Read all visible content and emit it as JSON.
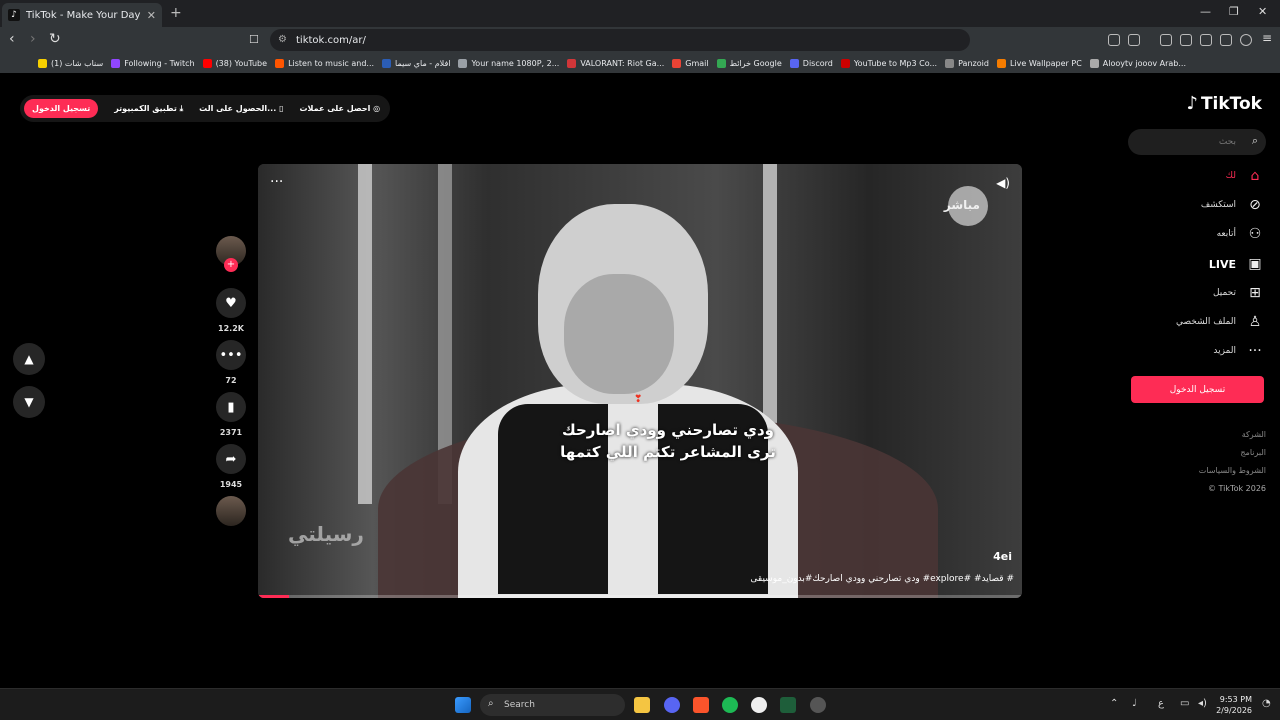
{
  "browser": {
    "tab_title": "TikTok - Make Your Day",
    "url": "tiktok.com/ar/",
    "bookmarks": [
      "(1) سناب شات",
      "Following - Twitch",
      "(38) YouTube",
      "Listen to music and...",
      "افلام - ماي سيما",
      "Your name 1080P, 2...",
      "VALORANT: Riot Ga...",
      "Gmail",
      "خرائط Google",
      "Discord",
      "YouTube to Mp3 Co...",
      "Panzoid",
      "Live Wallpaper PC",
      "Alooytv jooov Arab..."
    ],
    "bookmark_colors": [
      "#f7d000",
      "#9146ff",
      "#ff0000",
      "#ff5500",
      "#2b5db5",
      "#9aa0a6",
      "#d13639",
      "#ea4335",
      "#34a853",
      "#5865f2",
      "#c00",
      "#888",
      "#f57c00",
      "#aaa"
    ]
  },
  "header_actions": {
    "login": "تسجيل الدخول",
    "desktop_app": "تطبيق الكمبيوتر",
    "get_app": "الحصول على الت...",
    "coins": "احصل على عملات"
  },
  "logo": "TikTok",
  "search": {
    "placeholder": "بحث"
  },
  "nav": [
    {
      "label": "لك",
      "icon": "home-icon"
    },
    {
      "label": "استكشف",
      "icon": "compass-icon"
    },
    {
      "label": "أتابعه",
      "icon": "following-icon"
    },
    {
      "label": "LIVE",
      "icon": "live-icon"
    },
    {
      "label": "تحميل",
      "icon": "upload-icon"
    },
    {
      "label": "الملف الشخصي",
      "icon": "profile-icon"
    },
    {
      "label": "المزيد",
      "icon": "more-icon"
    }
  ],
  "sidebar_login": "تسجيل الدخول",
  "footer": [
    "الشركة",
    "البرنامج",
    "الشروط والسياسات",
    "© TikTok 2026"
  ],
  "video": {
    "channel_text": "مباشر",
    "subtitle_line1": "ودي تصارحني وودي اصارحك",
    "subtitle_line2": "ترى المشاعر تكتم اللي كتمها",
    "watermark": "رسيلتي",
    "author": "4ei",
    "caption": "ودي تصارحني وودي اصارحك#بدون_موسيقى #explore# #قصايد #",
    "progress": 0.04
  },
  "actions": {
    "likes": "12.2K",
    "comments": "72",
    "saves": "2371",
    "shares": "1945"
  },
  "taskbar": {
    "search": "Search",
    "time": "9:53 PM",
    "date": "2/9/2026",
    "lang": "ع"
  }
}
